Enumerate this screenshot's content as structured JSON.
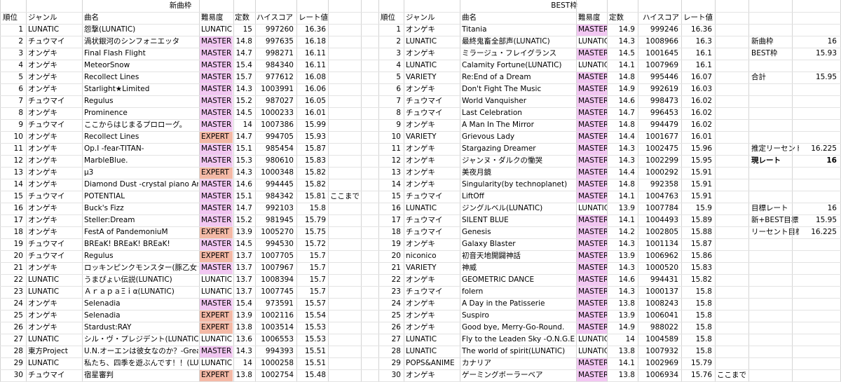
{
  "title_new": "新曲枠",
  "title_best": "BEST枠",
  "headers_new": {
    "rank": "順位",
    "genre": "ジャンル",
    "song": "曲名",
    "diff": "難易度",
    "const": "定数",
    "score": "ハイスコア",
    "rate": "レート値"
  },
  "headers_best": {
    "rank": "順位",
    "genre": "ジャンル",
    "song": "曲名",
    "diff": "難易度",
    "const": "定数",
    "score": "ハイスコア",
    "rate": "レート値"
  },
  "colors": {
    "master": "#f2c7f2",
    "expert": "#f4b9a6",
    "lunatic": "#ffffff"
  },
  "new_rows": [
    {
      "rank": "1",
      "genre": "LUNATIC",
      "song": "怨撃(LUNATIC)",
      "diff": "LUNATIC",
      "const": "15",
      "score": "997260",
      "rate": "16.36",
      "note": ""
    },
    {
      "rank": "2",
      "genre": "チュウマイ",
      "song": "渦状銀河のシンフォニエッタ",
      "diff": "MASTER",
      "const": "14.8",
      "score": "997635",
      "rate": "16.18",
      "note": ""
    },
    {
      "rank": "3",
      "genre": "オンゲキ",
      "song": "Final Flash Flight",
      "diff": "MASTER",
      "const": "14.7",
      "score": "998271",
      "rate": "16.11",
      "note": ""
    },
    {
      "rank": "4",
      "genre": "オンゲキ",
      "song": "MeteorSnow",
      "diff": "MASTER",
      "const": "15.4",
      "score": "984340",
      "rate": "16.11",
      "note": ""
    },
    {
      "rank": "5",
      "genre": "オンゲキ",
      "song": "Recollect Lines",
      "diff": "MASTER",
      "const": "15.7",
      "score": "977612",
      "rate": "16.08",
      "note": ""
    },
    {
      "rank": "6",
      "genre": "オンゲキ",
      "song": "Starlight★Limited",
      "diff": "MASTER",
      "const": "14.3",
      "score": "1003991",
      "rate": "16.06",
      "note": ""
    },
    {
      "rank": "7",
      "genre": "チュウマイ",
      "song": "Regulus",
      "diff": "MASTER",
      "const": "15.2",
      "score": "987027",
      "rate": "16.05",
      "note": ""
    },
    {
      "rank": "8",
      "genre": "オンゲキ",
      "song": "Prominence",
      "diff": "MASTER",
      "const": "14.5",
      "score": "1000233",
      "rate": "16.01",
      "note": ""
    },
    {
      "rank": "9",
      "genre": "チュウマイ",
      "song": "ここからはじまるプロローグ。",
      "diff": "MASTER",
      "const": "14",
      "score": "1007386",
      "rate": "15.99",
      "note": ""
    },
    {
      "rank": "10",
      "genre": "オンゲキ",
      "song": "Recollect Lines",
      "diff": "EXPERT",
      "const": "14.7",
      "score": "994705",
      "rate": "15.93",
      "note": ""
    },
    {
      "rank": "11",
      "genre": "オンゲキ",
      "song": "Op.I  -fear-TITAN-",
      "diff": "MASTER",
      "const": "15.1",
      "score": "985454",
      "rate": "15.87",
      "note": ""
    },
    {
      "rank": "12",
      "genre": "オンゲキ",
      "song": "MarbleBlue.",
      "diff": "MASTER",
      "const": "15.3",
      "score": "980610",
      "rate": "15.83",
      "note": ""
    },
    {
      "rank": "13",
      "genre": "オンゲキ",
      "song": "μ3",
      "diff": "EXPERT",
      "const": "14.3",
      "score": "1000348",
      "rate": "15.82",
      "note": ""
    },
    {
      "rank": "14",
      "genre": "オンゲキ",
      "song": "Diamond Dust -crystal piano Arr.-",
      "diff": "MASTER",
      "const": "14.6",
      "score": "994445",
      "rate": "15.82",
      "note": ""
    },
    {
      "rank": "15",
      "genre": "チュウマイ",
      "song": "POTENTIAL",
      "diff": "MASTER",
      "const": "15.1",
      "score": "984342",
      "rate": "15.81",
      "note": "ここまで"
    },
    {
      "rank": "16",
      "genre": "オンゲキ",
      "song": "Buck's Fizz",
      "diff": "MASTER",
      "const": "14.7",
      "score": "992103",
      "rate": "15.8",
      "note": ""
    },
    {
      "rank": "17",
      "genre": "オンゲキ",
      "song": "Steller:Dream",
      "diff": "MASTER",
      "const": "15.2",
      "score": "981945",
      "rate": "15.79",
      "note": ""
    },
    {
      "rank": "18",
      "genre": "オンゲキ",
      "song": "FestA of PandemoniuM",
      "diff": "EXPERT",
      "const": "13.9",
      "score": "1005270",
      "rate": "15.75",
      "note": ""
    },
    {
      "rank": "19",
      "genre": "チュウマイ",
      "song": "BREaK! BREaK! BREaK!",
      "diff": "MASTER",
      "const": "14.5",
      "score": "994530",
      "rate": "15.72",
      "note": ""
    },
    {
      "rank": "20",
      "genre": "チュウマイ",
      "song": "Regulus",
      "diff": "EXPERT",
      "const": "13.7",
      "score": "1007705",
      "rate": "15.7",
      "note": ""
    },
    {
      "rank": "21",
      "genre": "オンゲキ",
      "song": "ロッキンピンクモンスター(豚乙女ラン",
      "diff": "MASTER",
      "const": "13.7",
      "score": "1007967",
      "rate": "15.7",
      "note": ""
    },
    {
      "rank": "22",
      "genre": "LUNATIC",
      "song": "うまぴょい伝説(LUNATIC)",
      "diff": "LUNATIC",
      "const": "13.7",
      "score": "1008394",
      "rate": "15.7",
      "note": ""
    },
    {
      "rank": "23",
      "genre": "LUNATIC",
      "song": "ＡｒａｐａΞｉα(LUNATIC)",
      "diff": "LUNATIC",
      "const": "13.7",
      "score": "1007745",
      "rate": "15.7",
      "note": ""
    },
    {
      "rank": "24",
      "genre": "オンゲキ",
      "song": "Selenadia",
      "diff": "MASTER",
      "const": "15.4",
      "score": "973591",
      "rate": "15.57",
      "note": ""
    },
    {
      "rank": "25",
      "genre": "オンゲキ",
      "song": "Selenadia",
      "diff": "EXPERT",
      "const": "13.9",
      "score": "1002116",
      "rate": "15.54",
      "note": ""
    },
    {
      "rank": "26",
      "genre": "オンゲキ",
      "song": "Stardust:RAY",
      "diff": "EXPERT",
      "const": "13.8",
      "score": "1003514",
      "rate": "15.53",
      "note": ""
    },
    {
      "rank": "27",
      "genre": "LUNATIC",
      "song": "シル・ヴ・プレジデント(LUNATIC)",
      "diff": "LUNATIC",
      "const": "13.6",
      "score": "1006553",
      "rate": "15.53",
      "note": ""
    },
    {
      "rank": "28",
      "genre": "東方Project",
      "song": "U.N.オーエンは彼女なのか？-Greater",
      "diff": "MASTER",
      "const": "14.3",
      "score": "994393",
      "rate": "15.51",
      "note": ""
    },
    {
      "rank": "29",
      "genre": "LUNATIC",
      "song": "私たち、四季を遊ぶんです！！(LUNA",
      "diff": "LUNATIC",
      "const": "14",
      "score": "1000258",
      "rate": "15.51",
      "note": ""
    },
    {
      "rank": "30",
      "genre": "チュウマイ",
      "song": "宿星審判",
      "diff": "EXPERT",
      "const": "13.8",
      "score": "1002754",
      "rate": "15.48",
      "note": ""
    }
  ],
  "best_rows": [
    {
      "rank": "1",
      "genre": "オンゲキ",
      "song": "Titania",
      "diff": "MASTER",
      "const": "14.9",
      "score": "999246",
      "rate": "16.36",
      "note": ""
    },
    {
      "rank": "2",
      "genre": "LUNATIC",
      "song": "最終鬼畜全部声(LUNATIC)",
      "diff": "LUNATIC",
      "const": "14.3",
      "score": "1008966",
      "rate": "16.3",
      "note": ""
    },
    {
      "rank": "3",
      "genre": "オンゲキ",
      "song": "ミラージュ・フレイグランス",
      "diff": "MASTER",
      "const": "14.5",
      "score": "1001645",
      "rate": "16.1",
      "note": ""
    },
    {
      "rank": "4",
      "genre": "LUNATIC",
      "song": "Calamity Fortune(LUNATIC)",
      "diff": "LUNATIC",
      "const": "14.1",
      "score": "1007969",
      "rate": "16.1",
      "note": ""
    },
    {
      "rank": "5",
      "genre": "VARIETY",
      "song": "Re:End of a Dream",
      "diff": "MASTER",
      "const": "14.8",
      "score": "995446",
      "rate": "16.07",
      "note": ""
    },
    {
      "rank": "6",
      "genre": "オンゲキ",
      "song": "Don't Fight The Music",
      "diff": "MASTER",
      "const": "14.9",
      "score": "992619",
      "rate": "16.03",
      "note": ""
    },
    {
      "rank": "7",
      "genre": "チュウマイ",
      "song": "World Vanquisher",
      "diff": "MASTER",
      "const": "14.6",
      "score": "998473",
      "rate": "16.02",
      "note": ""
    },
    {
      "rank": "8",
      "genre": "チュウマイ",
      "song": "Last Celebration",
      "diff": "MASTER",
      "const": "14.7",
      "score": "996453",
      "rate": "16.02",
      "note": ""
    },
    {
      "rank": "9",
      "genre": "オンゲキ",
      "song": "A Man In The Mirror",
      "diff": "MASTER",
      "const": "14.8",
      "score": "994479",
      "rate": "16.02",
      "note": ""
    },
    {
      "rank": "10",
      "genre": "VARIETY",
      "song": "Grievous Lady",
      "diff": "MASTER",
      "const": "14.4",
      "score": "1001677",
      "rate": "16.01",
      "note": ""
    },
    {
      "rank": "11",
      "genre": "オンゲキ",
      "song": "Stargazing Dreamer",
      "diff": "MASTER",
      "const": "14.3",
      "score": "1002475",
      "rate": "15.96",
      "note": ""
    },
    {
      "rank": "12",
      "genre": "オンゲキ",
      "song": "ジャンヌ・ダルクの慟哭",
      "diff": "MASTER",
      "const": "14.3",
      "score": "1002299",
      "rate": "15.95",
      "note": ""
    },
    {
      "rank": "13",
      "genre": "オンゲキ",
      "song": "美夜月鏡",
      "diff": "MASTER",
      "const": "14.4",
      "score": "1000292",
      "rate": "15.91",
      "note": ""
    },
    {
      "rank": "14",
      "genre": "オンゲキ",
      "song": "Singularity(by technoplanet)",
      "diff": "MASTER",
      "const": "14.8",
      "score": "992358",
      "rate": "15.91",
      "note": ""
    },
    {
      "rank": "15",
      "genre": "チュウマイ",
      "song": "LiftOff",
      "diff": "MASTER",
      "const": "14.1",
      "score": "1004763",
      "rate": "15.91",
      "note": ""
    },
    {
      "rank": "16",
      "genre": "LUNATIC",
      "song": "ジングルベル(LUNATIC)",
      "diff": "LUNATIC",
      "const": "13.9",
      "score": "1007784",
      "rate": "15.9",
      "note": ""
    },
    {
      "rank": "17",
      "genre": "チュウマイ",
      "song": "SILENT BLUE",
      "diff": "MASTER",
      "const": "14.1",
      "score": "1004493",
      "rate": "15.89",
      "note": ""
    },
    {
      "rank": "18",
      "genre": "チュウマイ",
      "song": "Genesis",
      "diff": "MASTER",
      "const": "14.2",
      "score": "1002805",
      "rate": "15.88",
      "note": ""
    },
    {
      "rank": "19",
      "genre": "オンゲキ",
      "song": "Galaxy Blaster",
      "diff": "MASTER",
      "const": "14.3",
      "score": "1001134",
      "rate": "15.87",
      "note": ""
    },
    {
      "rank": "20",
      "genre": "niconico",
      "song": "初音天地開闢神話",
      "diff": "MASTER",
      "const": "13.9",
      "score": "1006962",
      "rate": "15.86",
      "note": ""
    },
    {
      "rank": "21",
      "genre": "VARIETY",
      "song": "神威",
      "diff": "MASTER",
      "const": "14.3",
      "score": "1000520",
      "rate": "15.83",
      "note": ""
    },
    {
      "rank": "22",
      "genre": "オンゲキ",
      "song": "GEOMETRIC DANCE",
      "diff": "MASTER",
      "const": "14.6",
      "score": "994431",
      "rate": "15.82",
      "note": ""
    },
    {
      "rank": "23",
      "genre": "チュウマイ",
      "song": "folern",
      "diff": "MASTER",
      "const": "14.3",
      "score": "1000137",
      "rate": "15.8",
      "note": ""
    },
    {
      "rank": "24",
      "genre": "オンゲキ",
      "song": "A Day in the Patisserie",
      "diff": "MASTER",
      "const": "13.8",
      "score": "1008243",
      "rate": "15.8",
      "note": ""
    },
    {
      "rank": "25",
      "genre": "オンゲキ",
      "song": "Suspiro",
      "diff": "MASTER",
      "const": "13.9",
      "score": "1006041",
      "rate": "15.8",
      "note": ""
    },
    {
      "rank": "26",
      "genre": "オンゲキ",
      "song": "Good bye, Merry-Go-Round.",
      "diff": "MASTER",
      "const": "14.9",
      "score": "988022",
      "rate": "15.8",
      "note": ""
    },
    {
      "rank": "27",
      "genre": "LUNATIC",
      "song": "Fly to the Leaden Sky -O.N.G.E.K.I. M",
      "diff": "LUNATIC",
      "const": "14",
      "score": "1004589",
      "rate": "15.8",
      "note": ""
    },
    {
      "rank": "28",
      "genre": "LUNATIC",
      "song": "The world of spirit(LUNATIC)",
      "diff": "LUNATIC",
      "const": "13.8",
      "score": "1007932",
      "rate": "15.8",
      "note": ""
    },
    {
      "rank": "29",
      "genre": "POPS&ANIME",
      "song": "カナリア",
      "diff": "MASTER",
      "const": "14.1",
      "score": "1002969",
      "rate": "15.79",
      "note": ""
    },
    {
      "rank": "30",
      "genre": "オンゲキ",
      "song": "ゲーミングボーラーベア",
      "diff": "MASTER",
      "const": "13.8",
      "score": "1006934",
      "rate": "15.76",
      "note": "ここまで"
    }
  ],
  "summary": [
    {
      "label": "",
      "value": ""
    },
    {
      "label": "新曲枠",
      "value": "16"
    },
    {
      "label": "BEST枠",
      "value": "15.93"
    },
    {
      "label": "",
      "value": ""
    },
    {
      "label": "合計",
      "value": "15.95"
    },
    {
      "label": "",
      "value": ""
    },
    {
      "label": "",
      "value": ""
    },
    {
      "label": "",
      "value": ""
    },
    {
      "label": "",
      "value": ""
    },
    {
      "label": "",
      "value": ""
    },
    {
      "label": "推定リーセント枠",
      "value": "16.225"
    },
    {
      "label": "現レート",
      "value": "16",
      "bold": true
    },
    {
      "label": "",
      "value": ""
    },
    {
      "label": "",
      "value": ""
    },
    {
      "label": "",
      "value": ""
    },
    {
      "label": "目標レート",
      "value": "16"
    },
    {
      "label": "新+BEST目標",
      "value": "15.95"
    },
    {
      "label": "リーセント目標",
      "value": "16.225"
    }
  ]
}
